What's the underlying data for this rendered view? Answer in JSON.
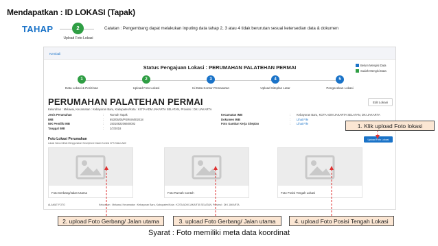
{
  "slide": {
    "title": "Mendapatkan : ID LOKASI (Tapak)",
    "tahap_label": "TAHAP",
    "tahap_step_number": "2",
    "tahap_step_name": "Upload Foto Lokasi",
    "catatan": "Catatan : Pengembang dapat melakukan inputing data tahap 2, 3 atau 4 tidak berurutan sesuai ketersedian data & dokumen"
  },
  "app": {
    "back_link": "Kembali",
    "status_title": "Status Pengajuan Lokasi : PERUMAHAN PALATEHAN PERMAI",
    "legend": [
      {
        "label": "Belum Mengisi Data",
        "color": "#1a73c8"
      },
      {
        "label": "Sudah Mengisi Data",
        "color": "#2f9e44"
      }
    ],
    "steps": [
      {
        "number": "1",
        "label": "Data Lokasi & Perizinan",
        "color": "#2f9e44"
      },
      {
        "number": "2",
        "label": "Upload Foto Lokasi",
        "color": "#2f9e44"
      },
      {
        "number": "3",
        "label": "Isi Data Kontor Pemasaran",
        "color": "#1a73c8"
      },
      {
        "number": "4",
        "label": "Upload Siteplan Latar",
        "color": "#1a73c8"
      },
      {
        "number": "5",
        "label": "Pengecekan Lokasi",
        "color": "#1a73c8"
      }
    ],
    "location_title": "PERUMAHAN PALATEHAN PERMAI",
    "edit_button": "Edit Lokasi",
    "address_line": "Kelurahan : Melawai, Kecamatan : Kebayoran Baru, Kabupaten/Kota : KOTA ADM JAKARTA SELATAN, Provinsi : DKI JAKARTA",
    "info_left": [
      {
        "key": "Jenis Perumahan",
        "value": "Rumah Tapak"
      },
      {
        "key": "IMB",
        "value": "653/05/05/PERKIM/I/2018"
      },
      {
        "key": "NIK Pemilik IMB",
        "value": "1501082206600002"
      },
      {
        "key": "Tanggal IMB",
        "value": "2/2/2018"
      }
    ],
    "info_right": [
      {
        "key": "Kecamatan IMB",
        "value": "Kebayoran Baru, KOTA ADM JAKARTA SELATAN, DKI JAKARTA",
        "link": false
      },
      {
        "key": "Dokumen IMB",
        "value": "Lihat File",
        "link": true
      },
      {
        "key": "Foto Gambar Kerja Siteplan",
        "value": "Lihat File",
        "link": true
      }
    ],
    "photo_section_title": "Foto Lokasi Perumahan",
    "photo_section_sub": "Lokasi Harus Dilihat Menggunakan Smartphone Dalam Kondisi GPS Status Aktif",
    "upload_button": "Upload Foto Lokasi",
    "photos": [
      {
        "caption": "Foto Gerbang/Jalan Utama"
      },
      {
        "caption": "Foto Rumah Contoh"
      },
      {
        "caption": "Foto Posisi Tengah Lokasi"
      }
    ],
    "footer_label": "ALAMAT FOTO",
    "footer_address": "Kelurahan : Melawai, Kecamatan : Kebayoran Baru, Kabupaten/Kota : KOTA ADM JAKARTA SELATAN, Provinsi : DKI JAKARTA"
  },
  "callouts": {
    "c1": "1. Klik upload Foto lokasi",
    "c2": "2. upload Foto Gerbang/ Jalan utama",
    "c3": "3. upload Foto Gerbang/ Jalan utama",
    "c4": "4. upload Foto Posisi Tengah Lokasi"
  },
  "syarat": "Syarat : Foto memiliki meta data koordinat",
  "colors": {
    "accent": "#1a73c8",
    "done": "#2f9e44",
    "arrow": "#e03131",
    "callout_bg": "#fbe6d3"
  },
  "icons": [
    "image-placeholder-icon"
  ]
}
